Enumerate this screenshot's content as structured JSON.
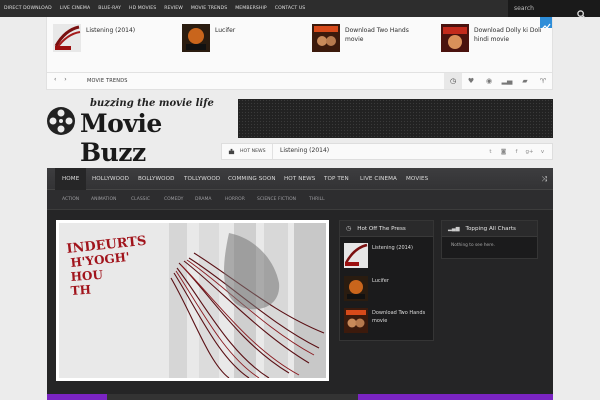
{
  "topnav": {
    "items": [
      "DIRECT DOWNLOAD",
      "LIVE CINEMA",
      "BLUE-RAY",
      "HD MOVIES",
      "REVIEW",
      "MOVIE TRENDS",
      "MEMBERSHIP",
      "CONTACT US"
    ]
  },
  "search": {
    "placeholder": "search",
    "icon": "search-icon"
  },
  "ticker": {
    "items": [
      {
        "title": "Listening (2014)"
      },
      {
        "title": "Lucifer"
      },
      {
        "title": "Download Two Hands movie"
      },
      {
        "title": "Download Dolly ki Doli hindi movie"
      }
    ],
    "label": "MOVIE TRENDS",
    "arrows": "‹ ›"
  },
  "logo": {
    "tagline": "buzzing the movie life",
    "title": "Movie Buzz"
  },
  "hotnews": {
    "label": "HOT NEWS",
    "text": "Listening (2014)"
  },
  "mainnav": {
    "items": [
      "HOME",
      "HOLLYWOOD",
      "BOLLYWOOD",
      "TOLLYWOOD",
      "COMMING SOON",
      "HOT NEWS",
      "TOP TEN",
      "LIVE CINEMA",
      "MOVIES"
    ]
  },
  "subnav": {
    "items": [
      "ACTION",
      "ANIMATION",
      "CLASSIC",
      "COMEDY",
      "DRAMA",
      "HORROR",
      "SCIENCE FICTION",
      "THRILL"
    ]
  },
  "slider": {
    "overlay_text": [
      "INDEURTS",
      "H'YOGH'",
      "HOU",
      "TH"
    ]
  },
  "widget_press": {
    "title": "Hot Off The Press",
    "items": [
      {
        "title": "Listening (2014)"
      },
      {
        "title": "Lucifer"
      },
      {
        "title": "Download Two Hands movie"
      }
    ]
  },
  "widget_charts": {
    "title": "Topping All Charts",
    "empty": "Nothing to see here."
  },
  "colors": {
    "accent_blue": "#2e8dd8",
    "accent_purple": "#7a24c2",
    "dark_bg": "#252526"
  }
}
